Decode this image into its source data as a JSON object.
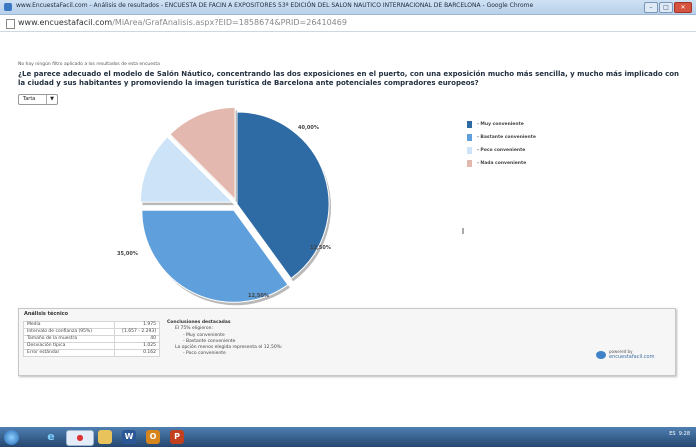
{
  "browser": {
    "window_title": "www.EncuestaFacil.com - Análisis de resultados - ENCUESTA DE FACIN A EXPOSITORES 53ª EDICIÓN DEL SALON NAUTICO INTERNACIONAL DE BARCELONA - Google Chrome",
    "url_host": "www.encuestafacil.com",
    "url_path": "/MiArea/GrafAnalisis.aspx?EID=1858674&PRID=26410469"
  },
  "page": {
    "filter_note": "No hay ningún filtro aplicado a los resultados de esta encuesta",
    "question": "¿Le parece adecuado el modelo de Salón Náutico, concentrando las dos exposiciones en el puerto, con una exposición mucho más sencilla, y mucho más implicado con la ciudad y sus habitantes y promoviendo la imagen turística de Barcelona ante potenciales compradores europeos?",
    "chart_type_select": "Tarta",
    "chart_type_arrow": "▼"
  },
  "chart_data": {
    "type": "pie",
    "slices": [
      {
        "label": "- Muy conveniente",
        "value": 40.0,
        "display": "40,00%",
        "color": "#2e6aa4"
      },
      {
        "label": "- Bastante conveniente",
        "value": 35.0,
        "display": "35,00%",
        "color": "#5f9fdc"
      },
      {
        "label": "- Poco conveniente",
        "value": 12.5,
        "display": "12,50%",
        "color": "#cde3f8"
      },
      {
        "label": "- Nada conveniente",
        "value": 12.5,
        "display": "12,50%",
        "color": "#e3b8ae"
      }
    ]
  },
  "analysis": {
    "heading": "Análisis técnico",
    "stats": [
      {
        "label": "Media",
        "value": "1.975"
      },
      {
        "label": "Intervalo de confianza (95%)",
        "value": "[1.657 - 2.293]"
      },
      {
        "label": "Tamaño de la muestra",
        "value": "40"
      },
      {
        "label": "Desviación típica",
        "value": "1.025"
      },
      {
        "label": "Error estándar",
        "value": "0.162"
      }
    ],
    "conclusions_heading": "Conclusiones destacadas",
    "line1": "El 75% eligieron:",
    "line2": "- Muy conveniente",
    "line3": "- Bastante conveniente",
    "line4": "La opción menos elegida representa el 12,50%:",
    "line5": "- Poco conveniente"
  },
  "brand": {
    "powered": "powered by",
    "name": "encuestafacil.com"
  },
  "taskbar": {
    "tray_lang": "ES",
    "clock": "9:28"
  }
}
